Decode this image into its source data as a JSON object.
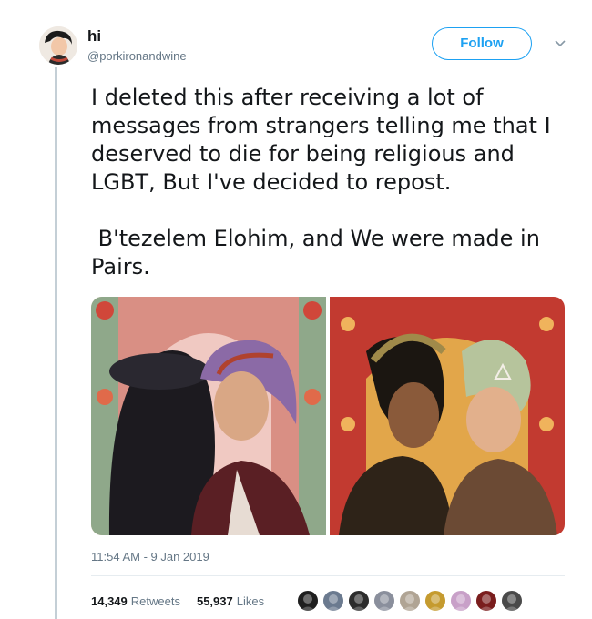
{
  "tweet": {
    "display_name": "hi",
    "handle": "@porkironandwine",
    "follow_label": "Follow",
    "text_p1": "I deleted this after receiving a lot of messages from strangers telling me that I deserved to die for being religious and LGBT, But I've decided to repost.",
    "text_p2": " B'tezelem Elohim, and We were made in Pairs.",
    "timestamp": "11:54 AM - 9 Jan 2019",
    "retweets_count": "14,349",
    "retweets_label": "Retweets",
    "likes_count": "55,937",
    "likes_label": "Likes"
  },
  "colors": {
    "accent": "#1da1f2",
    "secondary_text": "#657786",
    "primary_text": "#14171a"
  },
  "icons": {
    "caret": "chevron-down-icon"
  },
  "likers": [
    "#1f1f1f",
    "#6b7a8f",
    "#2d2d2d",
    "#8a8f9c",
    "#b0a494",
    "#c59b2f",
    "#c8a0c8",
    "#7a1d1d",
    "#4a4a4a"
  ]
}
